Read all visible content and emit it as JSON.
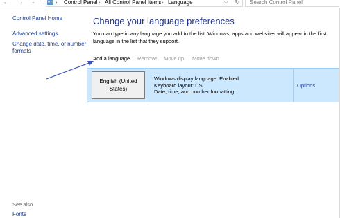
{
  "address_bar": {
    "back_icon": "back-arrow-icon",
    "forward_icon": "forward-arrow-icon",
    "up_icon": "up-arrow-icon",
    "breadcrumbs": [
      "Control Panel",
      "All Control Panel Items",
      "Language"
    ],
    "search_placeholder": "Search Control Panel"
  },
  "left_pane": {
    "home": "Control Panel Home",
    "links": [
      "Advanced settings",
      "Change date, time, or number formats"
    ],
    "see_also_heading": "See also",
    "see_also_links": [
      "Fonts"
    ]
  },
  "main": {
    "title": "Change your language preferences",
    "description": "You can type in any language you add to the list. Windows, apps and websites will appear in the first language in the list that they support.",
    "toolbar": {
      "add": "Add a language",
      "remove": "Remove",
      "move_up": "Move up",
      "move_down": "Move down"
    },
    "languages": [
      {
        "name": "English (United States)",
        "details": [
          "Windows display language: Enabled",
          "Keyboard layout: US",
          "Date, time, and number formatting"
        ],
        "options": "Options"
      }
    ]
  },
  "colors": {
    "title": "#1e3287",
    "link": "#1c3f94",
    "selection": "#cce8ff",
    "annotation_arrow": "#3b4fc4"
  }
}
